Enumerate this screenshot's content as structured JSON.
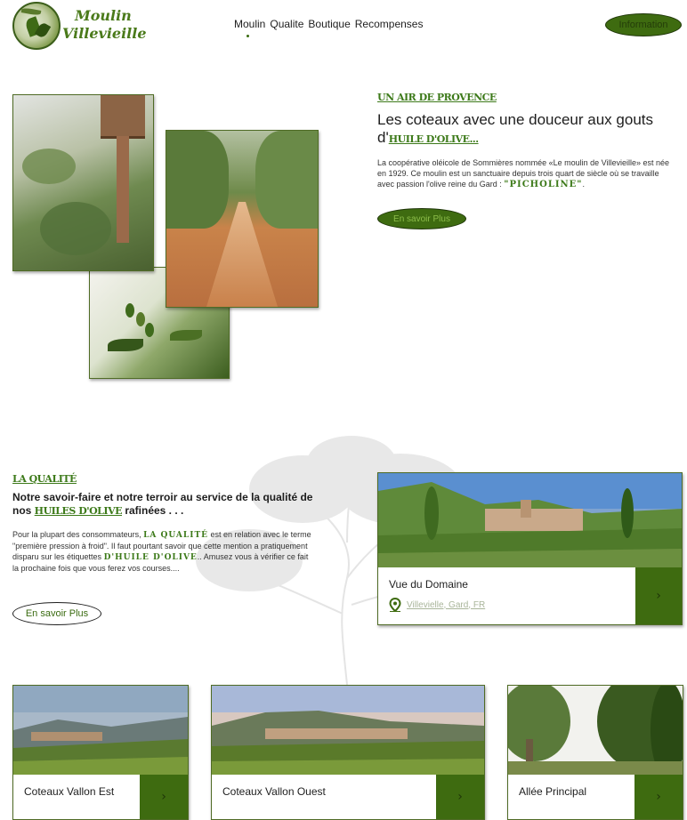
{
  "header": {
    "logo_line1": "Moulin",
    "logo_line2": "Villevieille",
    "nav": [
      "Moulin",
      "Qualite",
      "Boutique",
      "Recompenses"
    ],
    "info_button": "Information"
  },
  "intro": {
    "eyebrow": "UN AIR DE PROVENCE",
    "title_part1": "Les coteaux avec une douceur aux gouts d'",
    "title_highlight": "HUILE D'OLIVE...",
    "paragraph": "La coopérative oléicole de Sommières nommée «Le moulin de Villevieille» est née en 1929. Ce moulin est un sanctuaire depuis trois quart de siècle où se travaille avec passion l'olive reine du Gard : ",
    "paragraph_highlight": "\"Picholine\"",
    "paragraph_end": ".",
    "button": "En savoir Plus"
  },
  "quality": {
    "eyebrow": "LA QUALITÉ",
    "title_part1": "Notre savoir-faire et notre terroir au service de la qualité de nos ",
    "title_highlight": "HUILES D'OLIVE",
    "title_part2": " rafinées . . .",
    "p_part1": "Pour la plupart des consommateurs, ",
    "p_hl1": "la qualité",
    "p_part2": " est en relation avec le terme \"première pression à froid\". Il faut pourtant savoir que cette mention a pratiquement disparu sur les étiquettes ",
    "p_hl2": "d'Huile d'Olive",
    "p_part3": ".. Amusez vous à vérifier ce fait la prochaine fois que vous ferez vos courses....",
    "button": "En savoir Plus"
  },
  "domain_card": {
    "title": "Vue du Domaine",
    "location": "Villevielle, Gard, FR",
    "arrow": "›"
  },
  "cards": [
    {
      "title": "Coteaux Vallon Est",
      "arrow": "›"
    },
    {
      "title": "Coteaux Vallon Ouest",
      "arrow": "›"
    },
    {
      "title": "Allée Principal",
      "arrow": "›"
    }
  ],
  "colors": {
    "accent": "#3e6b10",
    "accent_text": "#3d7a1a"
  }
}
